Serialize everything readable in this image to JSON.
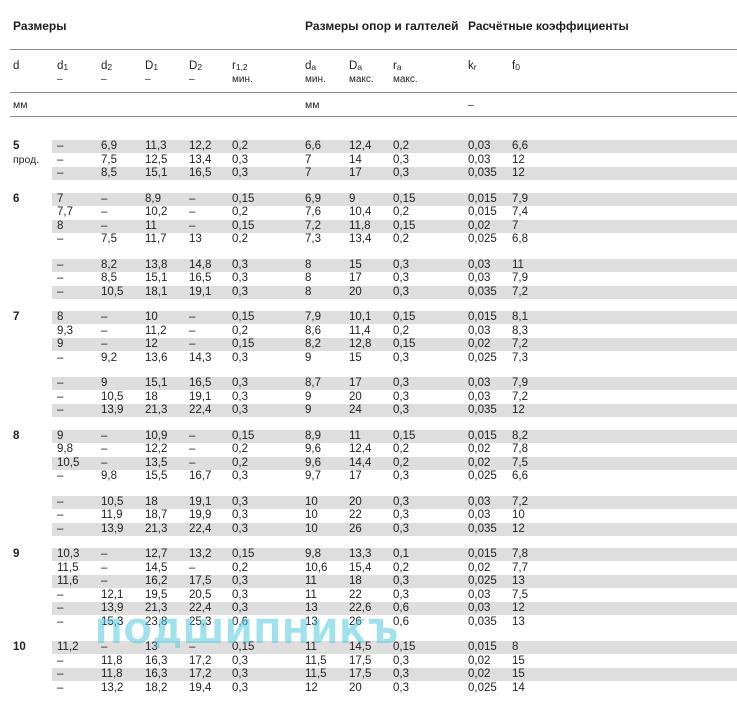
{
  "headers": {
    "sizes": "Размеры",
    "abutment": "Размеры опор и галтелей",
    "coefficients": "Расчётные коэффициенты"
  },
  "columns": [
    {
      "sym": "d",
      "sub": "",
      "sub2": ""
    },
    {
      "sym": "d",
      "sub": "1",
      "sub2": "–"
    },
    {
      "sym": "d",
      "sub": "2",
      "sub2": "–"
    },
    {
      "sym": "D",
      "sub": "1",
      "sub2": "–"
    },
    {
      "sym": "D",
      "sub": "2",
      "sub2": "–"
    },
    {
      "sym": "r",
      "sub": "1,2",
      "sub2": "мин."
    },
    {
      "sym": "d",
      "sub": "a",
      "sub2": "мин."
    },
    {
      "sym": "D",
      "sub": "a",
      "sub2": "макс."
    },
    {
      "sym": "r",
      "sub": "a",
      "sub2": "макс."
    },
    {
      "sym": "k",
      "sub": "r",
      "sub2": ""
    },
    {
      "sym": "f",
      "sub": "0",
      "sub2": ""
    }
  ],
  "units": {
    "sizes": "мм",
    "abutment": "мм",
    "coefficients": "–"
  },
  "groups": [
    {
      "d": "5",
      "note": "прод.",
      "blocks": [
        [
          [
            "–",
            "6,9",
            "11,3",
            "12,2",
            "0,2",
            "6,6",
            "12,4",
            "0,2",
            "0,03",
            "6,6"
          ],
          [
            "–",
            "7,5",
            "12,5",
            "13,4",
            "0,3",
            "7",
            "14",
            "0,3",
            "0,03",
            "12"
          ],
          [
            "–",
            "8,5",
            "15,1",
            "16,5",
            "0,3",
            "7",
            "17",
            "0,3",
            "0,035",
            "12"
          ]
        ]
      ]
    },
    {
      "d": "6",
      "note": "",
      "blocks": [
        [
          [
            "7",
            "–",
            "8,9",
            "–",
            "0,15",
            "6,9",
            "9",
            "0,15",
            "0,015",
            "7,9"
          ],
          [
            "7,7",
            "–",
            "10,2",
            "–",
            "0,2",
            "7,6",
            "10,4",
            "0,2",
            "0,015",
            "7,4"
          ],
          [
            "8",
            "–",
            "11",
            "–",
            "0,15",
            "7,2",
            "11,8",
            "0,15",
            "0,02",
            "7"
          ],
          [
            "–",
            "7,5",
            "11,7",
            "13",
            "0,2",
            "7,3",
            "13,4",
            "0,2",
            "0,025",
            "6,8"
          ]
        ],
        [
          [
            "–",
            "8,2",
            "13,8",
            "14,8",
            "0,3",
            "8",
            "15",
            "0,3",
            "0,03",
            "11"
          ],
          [
            "–",
            "8,5",
            "15,1",
            "16,5",
            "0,3",
            "8",
            "17",
            "0,3",
            "0,03",
            "7,9"
          ],
          [
            "–",
            "10,5",
            "18,1",
            "19,1",
            "0,3",
            "8",
            "20",
            "0,3",
            "0,035",
            "7,2"
          ]
        ]
      ]
    },
    {
      "d": "7",
      "note": "",
      "blocks": [
        [
          [
            "8",
            "–",
            "10",
            "–",
            "0,15",
            "7,9",
            "10,1",
            "0,15",
            "0,015",
            "8,1"
          ],
          [
            "9,3",
            "–",
            "11,2",
            "–",
            "0,2",
            "8,6",
            "11,4",
            "0,2",
            "0,03",
            "8,3"
          ],
          [
            "9",
            "–",
            "12",
            "–",
            "0,15",
            "8,2",
            "12,8",
            "0,15",
            "0,02",
            "7,2"
          ],
          [
            "–",
            "9,2",
            "13,6",
            "14,3",
            "0,3",
            "9",
            "15",
            "0,3",
            "0,025",
            "7,3"
          ]
        ],
        [
          [
            "–",
            "9",
            "15,1",
            "16,5",
            "0,3",
            "8,7",
            "17",
            "0,3",
            "0,03",
            "7,9"
          ],
          [
            "–",
            "10,5",
            "18",
            "19,1",
            "0,3",
            "9",
            "20",
            "0,3",
            "0,03",
            "7,2"
          ],
          [
            "–",
            "13,9",
            "21,3",
            "22,4",
            "0,3",
            "9",
            "24",
            "0,3",
            "0,035",
            "12"
          ]
        ]
      ]
    },
    {
      "d": "8",
      "note": "",
      "blocks": [
        [
          [
            "9",
            "–",
            "10,9",
            "–",
            "0,15",
            "8,9",
            "11",
            "0,15",
            "0,015",
            "8,2"
          ],
          [
            "9,8",
            "–",
            "12,2",
            "–",
            "0,2",
            "9,6",
            "12,4",
            "0,2",
            "0,02",
            "7,8"
          ],
          [
            "10,5",
            "–",
            "13,5",
            "–",
            "0,2",
            "9,6",
            "14,4",
            "0,2",
            "0,02",
            "7,5"
          ],
          [
            "–",
            "9,8",
            "15,5",
            "16,7",
            "0,3",
            "9,7",
            "17",
            "0,3",
            "0,025",
            "6,6"
          ]
        ],
        [
          [
            "–",
            "10,5",
            "18",
            "19,1",
            "0,3",
            "10",
            "20",
            "0,3",
            "0,03",
            "7,2"
          ],
          [
            "–",
            "11,9",
            "18,7",
            "19,9",
            "0,3",
            "10",
            "22",
            "0,3",
            "0,03",
            "10"
          ],
          [
            "–",
            "13,9",
            "21,3",
            "22,4",
            "0,3",
            "10",
            "26",
            "0,3",
            "0,035",
            "12"
          ]
        ]
      ]
    },
    {
      "d": "9",
      "note": "",
      "blocks": [
        [
          [
            "10,3",
            "–",
            "12,7",
            "13,2",
            "0,15",
            "9,8",
            "13,3",
            "0,1",
            "0,015",
            "7,8"
          ],
          [
            "11,5",
            "–",
            "14,5",
            "–",
            "0,2",
            "10,6",
            "15,4",
            "0,2",
            "0,02",
            "7,7"
          ],
          [
            "11,6",
            "–",
            "16,2",
            "17,5",
            "0,3",
            "11",
            "18",
            "0,3",
            "0,025",
            "13"
          ],
          [
            "–",
            "12,1",
            "19,5",
            "20,5",
            "0,3",
            "11",
            "22",
            "0,3",
            "0,03",
            "7,5"
          ],
          [
            "–",
            "13,9",
            "21,3",
            "22,4",
            "0,3",
            "13",
            "22,6",
            "0,6",
            "0,03",
            "12"
          ],
          [
            "–",
            "15,3",
            "23,8",
            "25,3",
            "0,6",
            "13",
            "26",
            "0,6",
            "0,035",
            "13"
          ]
        ]
      ]
    },
    {
      "d": "10",
      "note": "",
      "blocks": [
        [
          [
            "11,2",
            "–",
            "13",
            "–",
            "0,15",
            "11",
            "14,5",
            "0,15",
            "0,015",
            "8"
          ],
          [
            "–",
            "11,8",
            "16,3",
            "17,2",
            "0,3",
            "11,5",
            "17,5",
            "0,3",
            "0,02",
            "15"
          ],
          [
            "–",
            "11,8",
            "16,3",
            "17,2",
            "0,3",
            "11,5",
            "17,5",
            "0,3",
            "0,02",
            "15"
          ],
          [
            "–",
            "13,2",
            "18,2",
            "19,4",
            "0,3",
            "12",
            "20",
            "0,3",
            "0,025",
            "14"
          ]
        ]
      ]
    }
  ],
  "watermark": "ПОДШИПНИКЪ"
}
